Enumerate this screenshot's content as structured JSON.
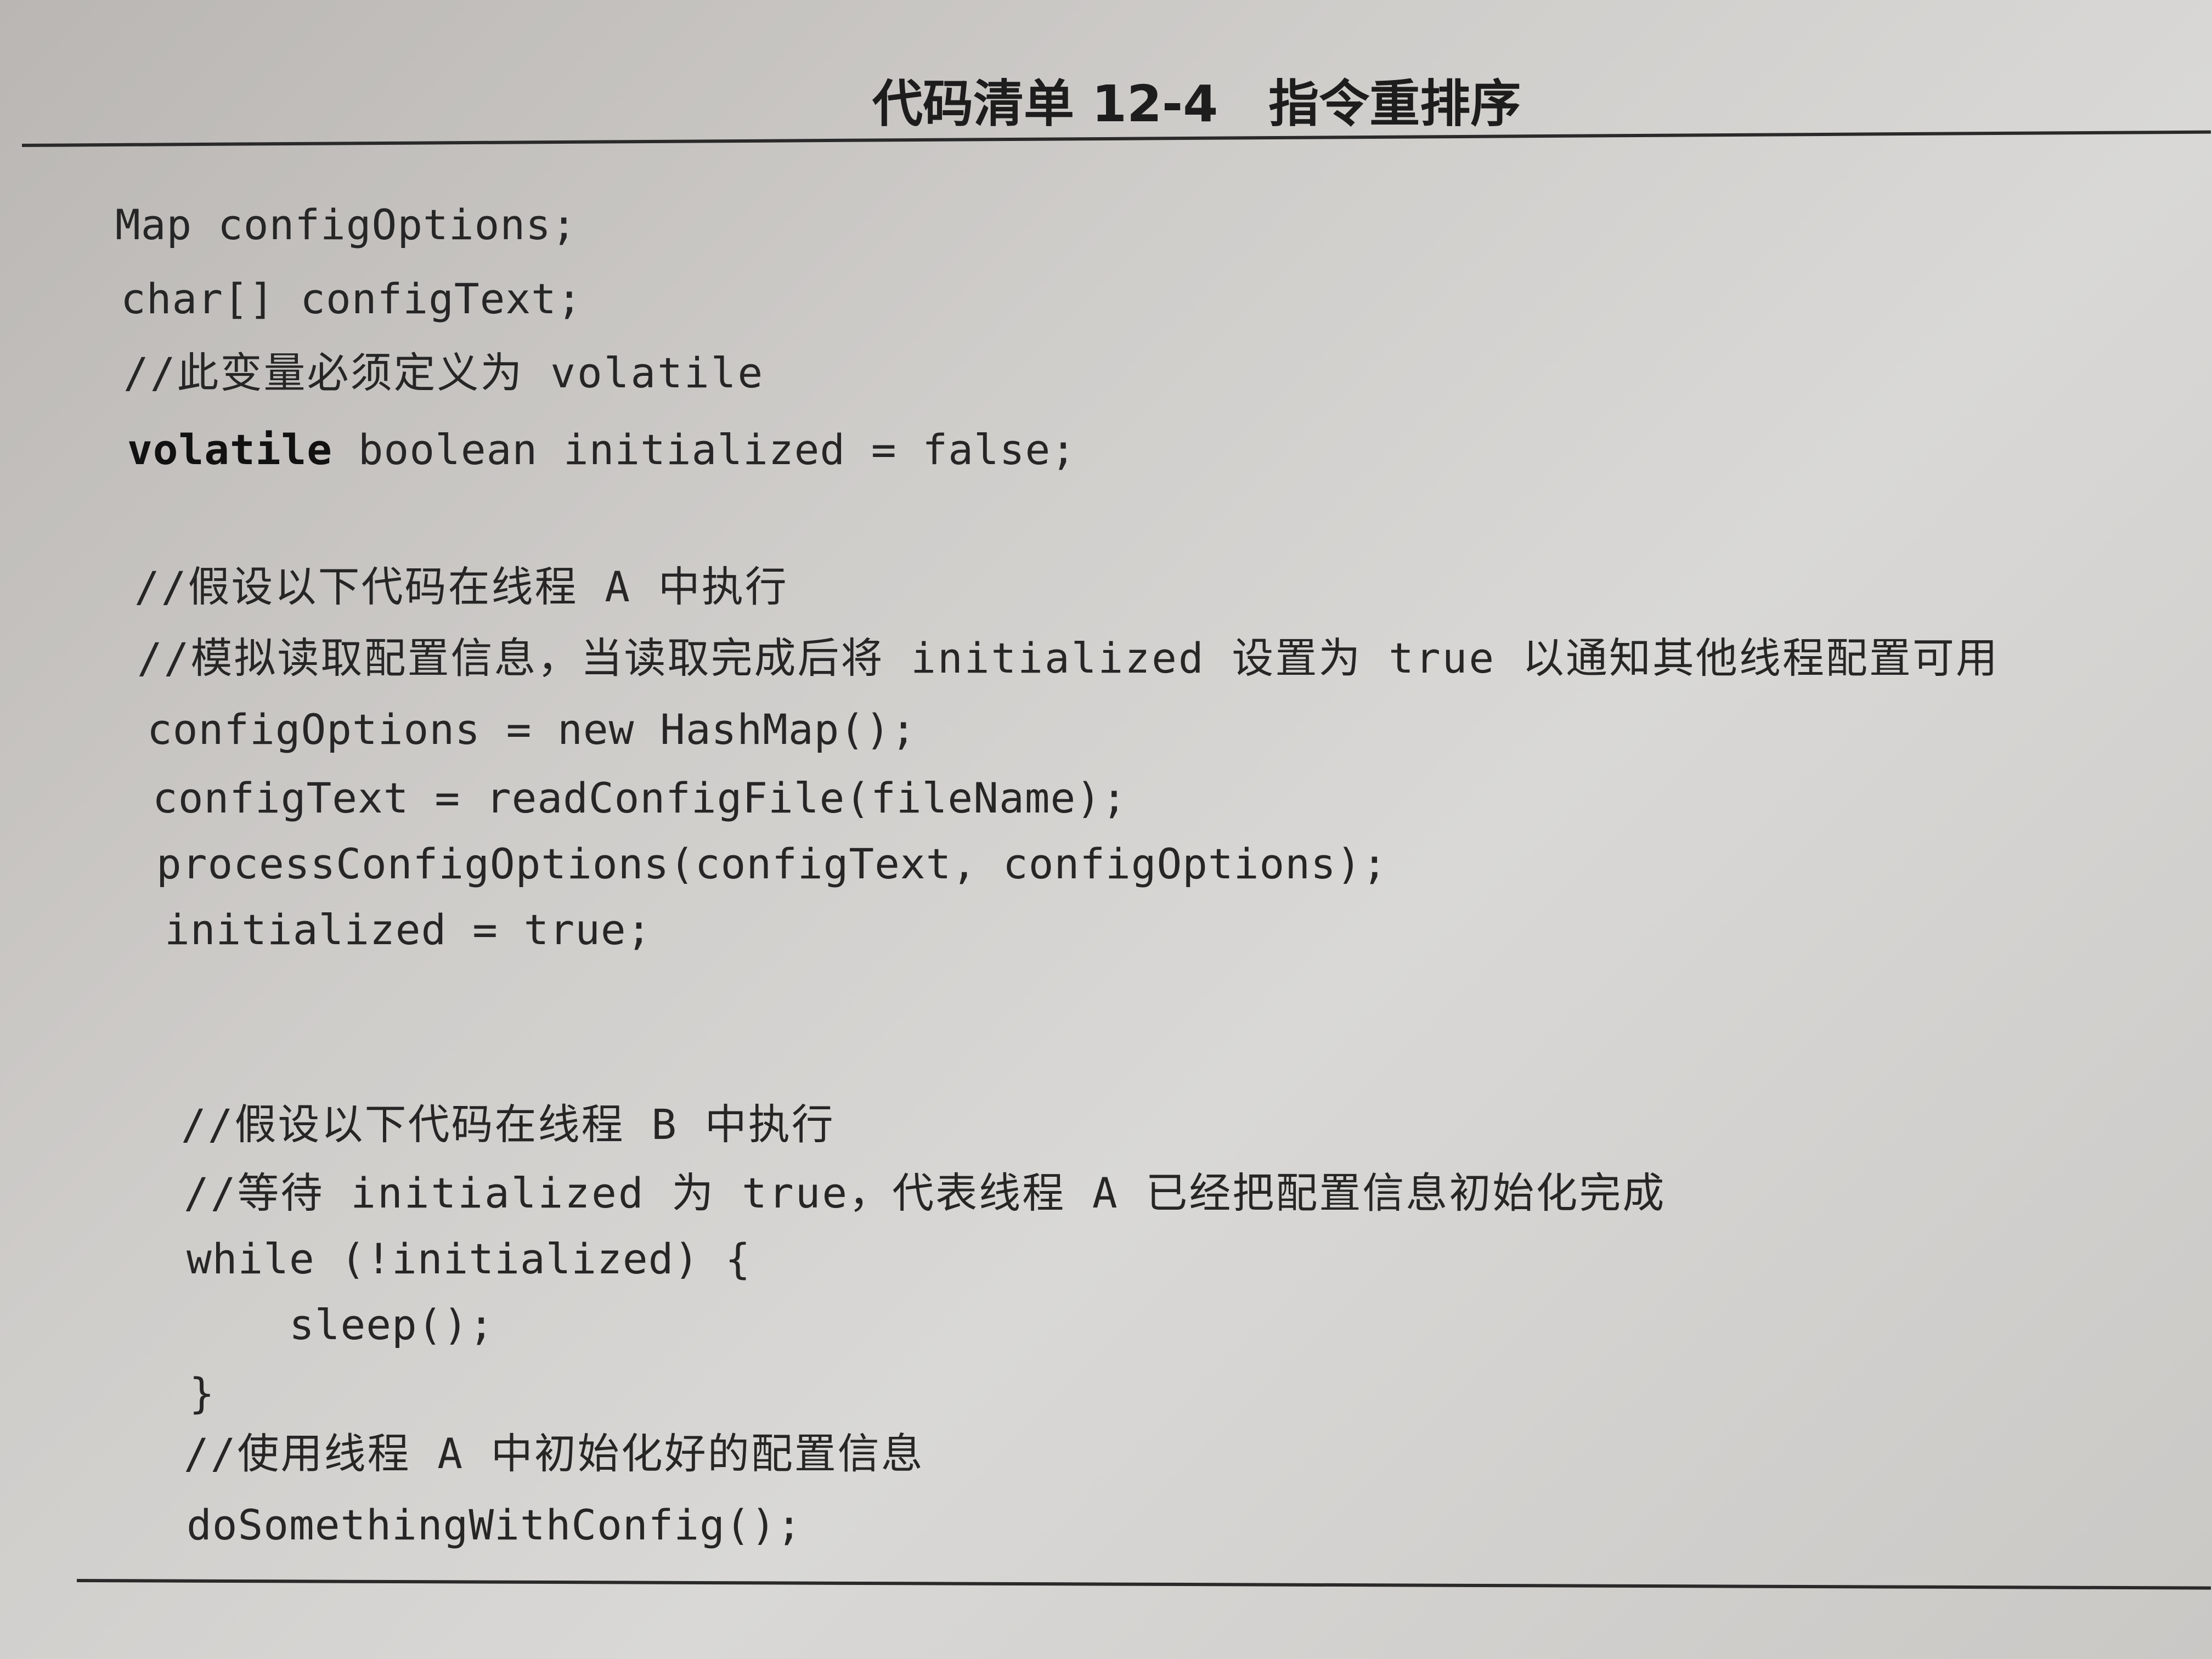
{
  "listing": {
    "title": "代码清单 12-4　指令重排序"
  },
  "code": {
    "l1": "Map configOptions;",
    "l2": "char[] configText;",
    "l3": "//此变量必须定义为 volatile",
    "l4_kw": "volatile",
    "l4_rest": " boolean initialized = false;",
    "l5": "//假设以下代码在线程 A 中执行",
    "l6": "//模拟读取配置信息，当读取完成后将 initialized 设置为 true 以通知其他线程配置可用",
    "l7": "configOptions = new HashMap();",
    "l8": "configText = readConfigFile(fileName);",
    "l9": "processConfigOptions(configText, configOptions);",
    "l10": "initialized = true;",
    "l11": "//假设以下代码在线程 B 中执行",
    "l12": "//等待 initialized 为 true，代表线程 A 已经把配置信息初始化完成",
    "l13": "while (!initialized) {",
    "l14": "    sleep();",
    "l15": "}",
    "l16": "//使用线程 A 中初始化好的配置信息",
    "l17": "doSomethingWithConfig();"
  }
}
